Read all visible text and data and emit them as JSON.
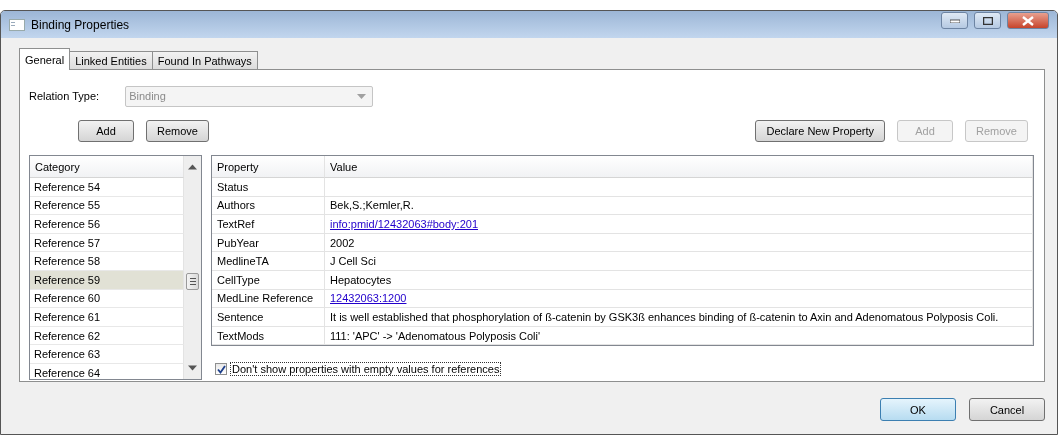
{
  "window": {
    "title": "Binding Properties"
  },
  "tabs": [
    {
      "label": "General",
      "selected": true
    },
    {
      "label": "Linked Entities",
      "selected": false
    },
    {
      "label": "Found In Pathways",
      "selected": false
    }
  ],
  "relation_type": {
    "label": "Relation Type:",
    "value": "Binding",
    "disabled": true
  },
  "category_buttons": [
    {
      "label": "Add",
      "disabled": false
    },
    {
      "label": "Remove",
      "disabled": false
    }
  ],
  "property_buttons": [
    {
      "label": "Declare New Property",
      "disabled": false
    },
    {
      "label": "Add",
      "disabled": true
    },
    {
      "label": "Remove",
      "disabled": true
    }
  ],
  "categories": {
    "header": "Category",
    "items": [
      {
        "label": "Reference 54",
        "selected": false
      },
      {
        "label": "Reference 55",
        "selected": false
      },
      {
        "label": "Reference 56",
        "selected": false
      },
      {
        "label": "Reference 57",
        "selected": false
      },
      {
        "label": "Reference 58",
        "selected": false
      },
      {
        "label": "Reference 59",
        "selected": true
      },
      {
        "label": "Reference 60",
        "selected": false
      },
      {
        "label": "Reference 61",
        "selected": false
      },
      {
        "label": "Reference 62",
        "selected": false
      },
      {
        "label": "Reference 63",
        "selected": false
      },
      {
        "label": "Reference 64",
        "selected": false
      }
    ]
  },
  "properties": {
    "columns": [
      "Property",
      "Value"
    ],
    "rows": [
      {
        "property": "Status",
        "value": "",
        "kind": "text"
      },
      {
        "property": "Authors",
        "value": "Bek,S.;Kemler,R.",
        "kind": "text"
      },
      {
        "property": "TextRef",
        "value": "info:pmid/12432063#body:201",
        "kind": "link"
      },
      {
        "property": "PubYear",
        "value": "2002",
        "kind": "text"
      },
      {
        "property": "MedlineTA",
        "value": "J Cell Sci",
        "kind": "text"
      },
      {
        "property": "CellType",
        "value": "Hepatocytes",
        "kind": "text"
      },
      {
        "property": "MedLine Reference",
        "value": "12432063:1200",
        "kind": "link"
      },
      {
        "property": "Sentence",
        "value": "It is well established that phosphorylation of ß-catenin by GSK3ß enhances binding of ß-catenin to Axin and Adenomatous Polyposis Coli.",
        "kind": "text"
      },
      {
        "property": "TextMods",
        "value": "111: 'APC' -> 'Adenomatous Polyposis Coli'",
        "kind": "text"
      }
    ]
  },
  "hide_empty": {
    "label": "Don't show properties with empty values for references",
    "checked": true
  },
  "dialog_buttons": [
    {
      "label": "OK",
      "default": true
    },
    {
      "label": "Cancel",
      "default": false
    }
  ]
}
